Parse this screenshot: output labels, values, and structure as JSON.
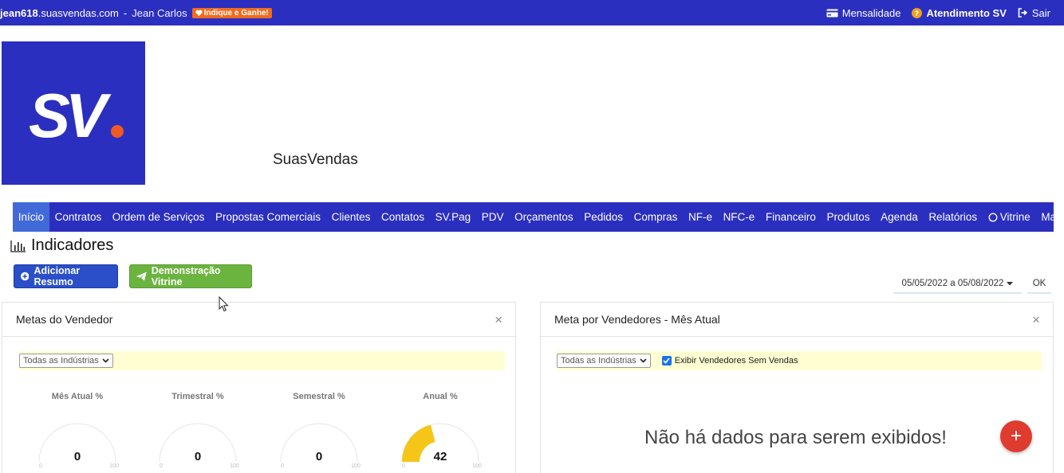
{
  "topbar": {
    "domain_bold": "jean618",
    "domain_rest": ".suasvendas.com",
    "separator": " - ",
    "user": "Jean Carlos",
    "refer_badge": "Indique e Ganhe!",
    "right_items": [
      {
        "label": "Mensalidade",
        "icon": "credit-card-icon"
      },
      {
        "label": "Atendimento SV",
        "icon": "help-circle-icon"
      },
      {
        "label": "Sair",
        "icon": "sign-out-icon"
      }
    ]
  },
  "brand": {
    "name": "SuasVendas",
    "logo_text": "SV"
  },
  "nav": {
    "items": [
      "Início",
      "Contratos",
      "Ordem de Serviços",
      "Propostas Comerciais",
      "Clientes",
      "Contatos",
      "SV.Pag",
      "PDV",
      "Orçamentos",
      "Pedidos",
      "Compras",
      "NF-e",
      "NFC-e",
      "Financeiro",
      "Produtos",
      "Agenda",
      "Relatórios",
      "Vitrine",
      "Mais"
    ],
    "active": "Início"
  },
  "page": {
    "title": "Indicadores"
  },
  "buttons": {
    "add_summary": "Adicionar Resumo",
    "demo_vitrine": "Demonstração Vitrine"
  },
  "date_filter": {
    "range": "05/05/2022 a 05/08/2022",
    "ok": "OK"
  },
  "panel_left": {
    "title": "Metas do Vendedor",
    "close": "×",
    "filter_select": "Todas as Indústrias",
    "gauges": [
      {
        "label": "Mês Atual %",
        "value": 0,
        "min": "0",
        "max": "100"
      },
      {
        "label": "Trimestral %",
        "value": 0,
        "min": "0",
        "max": "100"
      },
      {
        "label": "Semestral %",
        "value": 0,
        "min": "0",
        "max": "100"
      },
      {
        "label": "Anual %",
        "value": 42,
        "min": "0",
        "max": "100"
      }
    ]
  },
  "panel_right": {
    "title": "Meta por Vendedores - Mês Atual",
    "close": "×",
    "filter_select": "Todas as Indústrias",
    "checkbox_label": "Exibir Vendedores Sem Vendas",
    "checkbox_checked": true,
    "empty_message": "Não há dados para serem exibidos!"
  },
  "fab": {
    "label": "+"
  },
  "colors": {
    "primary": "#2b2fbf",
    "nav_active": "#4169d8",
    "badge": "#f06b1f",
    "btn_blue": "#2a4fc9",
    "btn_green": "#6bb43f",
    "gauge_fill": "#f5c518",
    "fab": "#e03b2f",
    "filter_bg": "#fefed2"
  }
}
